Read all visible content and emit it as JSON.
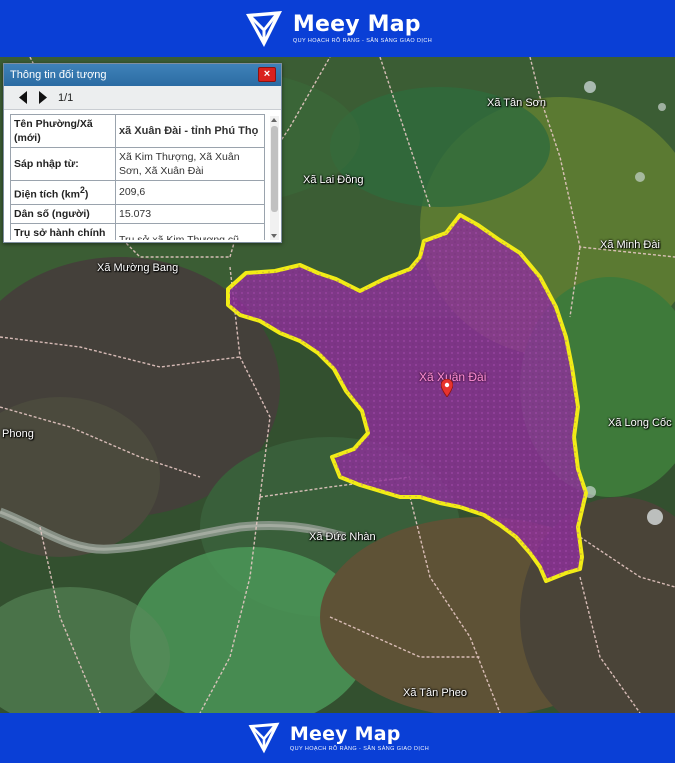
{
  "brand": {
    "name": "Meey Map",
    "tagline": "QUY HOẠCH RÕ RÀNG - SẴN SÀNG GIAO DỊCH",
    "color": "#0a3fd6"
  },
  "panel": {
    "title": "Thông tin đối tượng",
    "close_icon": "×",
    "pager": "1/1",
    "rows": [
      {
        "label": "Tên Phường/Xã (mới)",
        "value": "xã Xuân Đài - tỉnh Phú Thọ"
      },
      {
        "label": "Sáp nhập từ:",
        "value": "Xã Kim Thượng, Xã Xuân Sơn, Xã Xuân Đài"
      },
      {
        "label_main": "Diện tích (km",
        "label_sup": "2",
        "label_end": ")",
        "value": "209,6"
      },
      {
        "label": "Dân số (người)",
        "value": "15.073"
      },
      {
        "label": "Trụ sở hành chính (mới)",
        "value": "Trụ sở xã Kim Thượng cũ"
      }
    ]
  },
  "map": {
    "highlight_label": "Xã Xuân Đài",
    "highlight_fill": "#8e2f9a",
    "boundary_color": "#f2ec16",
    "places": [
      {
        "id": "tan-son",
        "name": "Xã Tân Sơn"
      },
      {
        "id": "lai-dong",
        "name": "Xã Lai Đồng"
      },
      {
        "id": "minh-dai",
        "name": "Xã Minh Đài"
      },
      {
        "id": "muong-bang",
        "name": "Xã Mường Bang"
      },
      {
        "id": "long-coc",
        "name": "Xã Long Cốc"
      },
      {
        "id": "phong",
        "name": "Phong"
      },
      {
        "id": "duc-nhan",
        "name": "Xã Đức Nhàn"
      },
      {
        "id": "tan-pheo",
        "name": "Xã Tân Pheo"
      }
    ]
  }
}
